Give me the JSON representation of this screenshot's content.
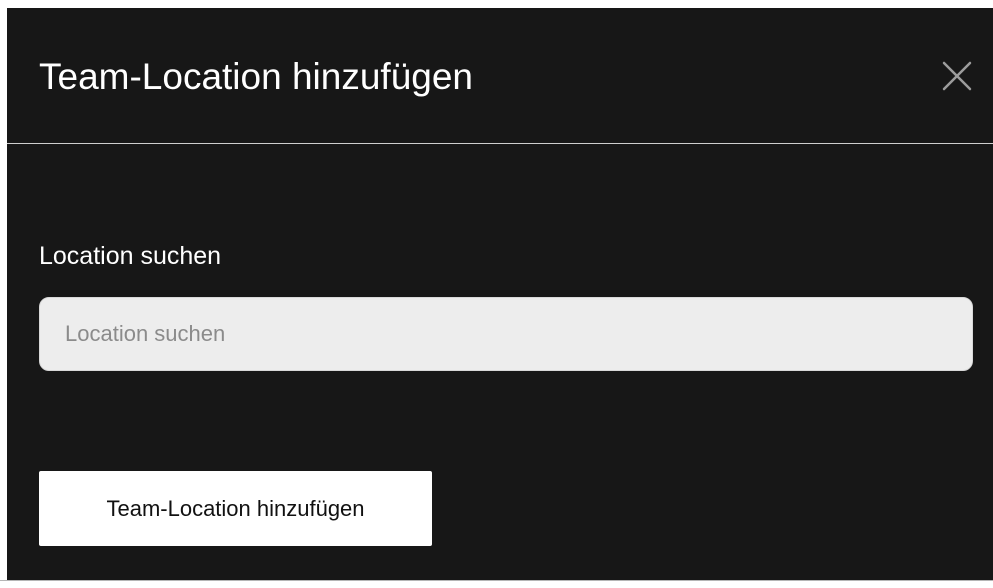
{
  "dialog": {
    "title": "Team-Location hinzufügen",
    "close_icon": "close-icon",
    "search": {
      "label": "Location suchen",
      "placeholder": "Location suchen",
      "value": ""
    },
    "submit_label": "Team-Location hinzufügen"
  },
  "colors": {
    "dialog_background": "#171717",
    "text": "#ffffff",
    "input_background": "#ededed",
    "button_background": "#ffffff",
    "button_text": "#111111"
  }
}
